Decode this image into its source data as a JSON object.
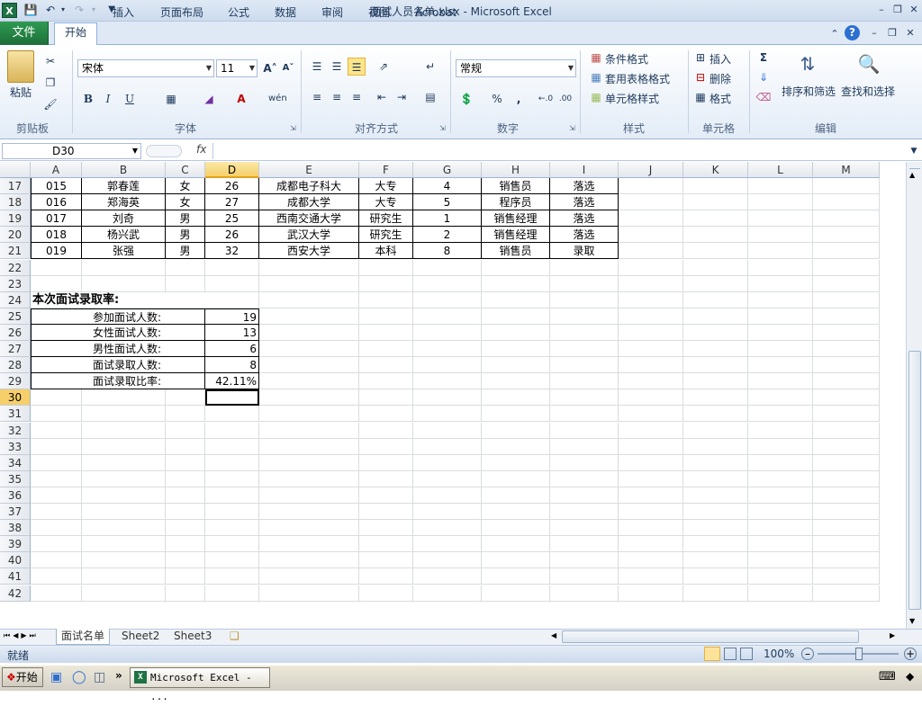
{
  "window": {
    "title": "面试人员名单.xlsx - Microsoft Excel"
  },
  "tabs": {
    "file": "文件",
    "home": "开始",
    "insert": "插入",
    "layout": "页面布局",
    "formula": "公式",
    "data": "数据",
    "review": "审阅",
    "view": "视图",
    "acrobat": "Acrobat"
  },
  "ribbon": {
    "clipboard": {
      "label": "剪贴板",
      "paste": "粘贴"
    },
    "font": {
      "label": "字体",
      "name": "宋体",
      "size": "11",
      "bold": "B",
      "italic": "I",
      "underline": "U"
    },
    "align": {
      "label": "对齐方式"
    },
    "number": {
      "label": "数字",
      "format": "常规",
      "percent": "%",
      "comma": ","
    },
    "styles": {
      "label": "样式",
      "cond": "条件格式",
      "table": "套用表格格式",
      "cell": "单元格样式"
    },
    "cells": {
      "label": "单元格",
      "insert": "插入",
      "delete": "删除",
      "format": "格式"
    },
    "edit": {
      "label": "编辑",
      "sigma": "Σ",
      "sort": "排序和筛选",
      "find": "查找和选择"
    }
  },
  "formula_bar": {
    "name_box": "D30",
    "fx": "fx",
    "content": ""
  },
  "columns": [
    "A",
    "B",
    "C",
    "D",
    "E",
    "F",
    "G",
    "H",
    "I",
    "J",
    "K",
    "L",
    "M"
  ],
  "rows": [
    "17",
    "18",
    "19",
    "20",
    "21",
    "22",
    "23",
    "24",
    "25",
    "26",
    "27",
    "28",
    "29",
    "30",
    "31",
    "32",
    "33",
    "34",
    "35",
    "36",
    "37",
    "38",
    "39",
    "40",
    "41",
    "42"
  ],
  "table": [
    [
      "015",
      "郭春莲",
      "女",
      "26",
      "成都电子科大",
      "大专",
      "4",
      "销售员",
      "落选"
    ],
    [
      "016",
      "郑海英",
      "女",
      "27",
      "成都大学",
      "大专",
      "5",
      "程序员",
      "落选"
    ],
    [
      "017",
      "刘奇",
      "男",
      "25",
      "西南交通大学",
      "研究生",
      "1",
      "销售经理",
      "落选"
    ],
    [
      "018",
      "杨兴武",
      "男",
      "26",
      "武汉大学",
      "研究生",
      "2",
      "销售经理",
      "落选"
    ],
    [
      "019",
      "张强",
      "男",
      "32",
      "西安大学",
      "本科",
      "8",
      "销售员",
      "录取"
    ]
  ],
  "summary": {
    "heading": "本次面试录取率:",
    "items": [
      {
        "label": "参加面试人数:",
        "value": "19"
      },
      {
        "label": "女性面试人数:",
        "value": "13"
      },
      {
        "label": "男性面试人数:",
        "value": "6"
      },
      {
        "label": "面试录取人数:",
        "value": "8"
      },
      {
        "label": "面试录取比率:",
        "value": "42.11%"
      }
    ]
  },
  "sheets": [
    "面试名单",
    "Sheet2",
    "Sheet3"
  ],
  "status": {
    "ready": "就绪",
    "zoom": "100%"
  },
  "taskbar": {
    "start": "开始",
    "app": "Microsoft Excel - ..."
  },
  "colors": {
    "file_tab": "#1f7244",
    "selected_header": "#f6cf6a",
    "ribbon_bg": "#e3ecf7"
  }
}
